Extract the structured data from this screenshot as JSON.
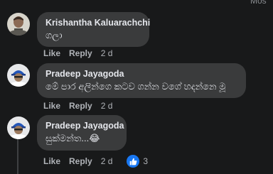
{
  "header_cut_text": "Mos",
  "comments": [
    {
      "author": "Krishantha Kaluarachchi",
      "text": "ගලා",
      "actions": {
        "like": "Like",
        "reply": "Reply",
        "time": "2 d"
      }
    },
    {
      "author": "Pradeep Jayagoda",
      "text": "මේ පාර අලින්ගෙ කටව ගන්න වගේ හදන්නෙ මූ",
      "actions": {
        "like": "Like",
        "reply": "Reply",
        "time": "2 d"
      }
    },
    {
      "author": "Pradeep Jayagoda",
      "text": "සුක්මන්ත...😂",
      "actions": {
        "like": "Like",
        "reply": "Reply",
        "time": "2 d"
      },
      "reaction": {
        "icon": "thumbs-up-icon",
        "count": "3",
        "color": "#1877f2"
      }
    }
  ]
}
